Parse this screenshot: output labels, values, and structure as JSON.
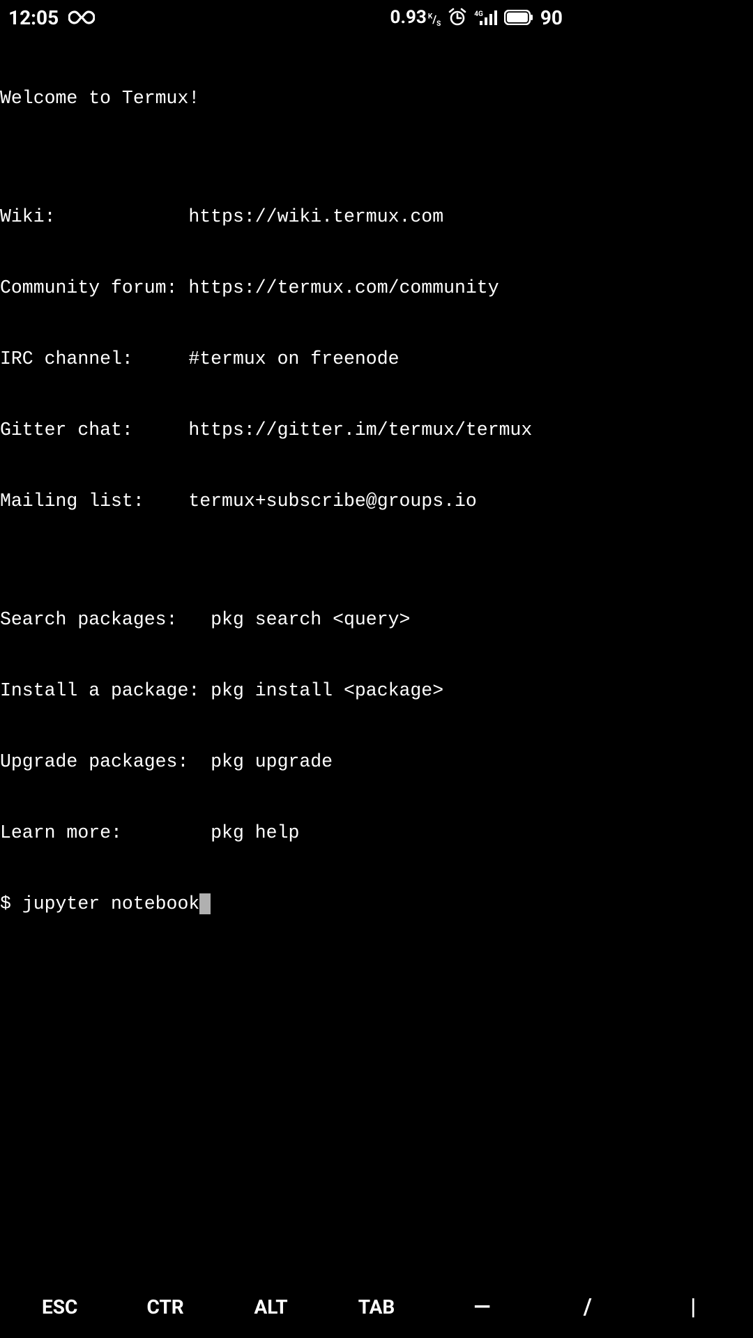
{
  "statusbar": {
    "time": "12:05",
    "net_speed_value": "0.93",
    "net_speed_unit": "K/s",
    "signal_gen": "4G",
    "battery_pct": "90"
  },
  "terminal": {
    "lines": [
      "Welcome to Termux!",
      "",
      "Wiki:            https://wiki.termux.com",
      "Community forum: https://termux.com/community",
      "IRC channel:     #termux on freenode",
      "Gitter chat:     https://gitter.im/termux/termux",
      "Mailing list:    termux+subscribe@groups.io",
      "",
      "Search packages:   pkg search <query>",
      "Install a package: pkg install <package>",
      "Upgrade packages:  pkg upgrade",
      "Learn more:        pkg help"
    ],
    "prompt": "$ ",
    "command": "jupyter notebook"
  },
  "extra_keys": {
    "esc": "ESC",
    "ctr": "CTR",
    "alt": "ALT",
    "tab": "TAB",
    "dash": "—",
    "slash": "/",
    "pipe": "|"
  }
}
